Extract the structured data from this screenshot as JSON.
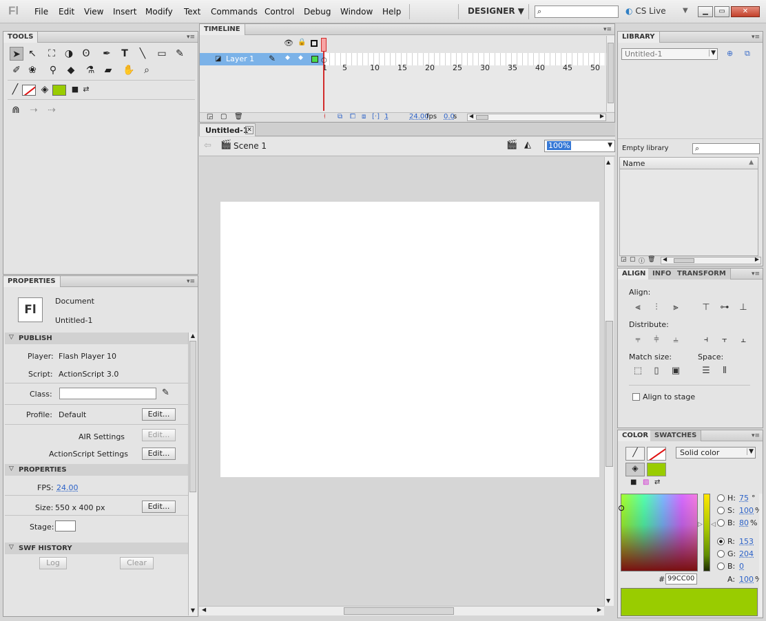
{
  "app": {
    "logo": "Fl",
    "menu": [
      "File",
      "Edit",
      "View",
      "Insert",
      "Modify",
      "Text",
      "Commands",
      "Control",
      "Debug",
      "Window",
      "Help"
    ],
    "workspace": "DESIGNER",
    "cs_live": "CS Live"
  },
  "tools_panel": {
    "title": "TOOLS"
  },
  "timeline": {
    "title": "TIMELINE",
    "layer_name": "Layer 1",
    "frame_numbers": [
      "1",
      "5",
      "10",
      "15",
      "20",
      "25",
      "30",
      "35",
      "40",
      "45",
      "50"
    ],
    "current_frame": "1",
    "fps": "24.00",
    "fps_unit": "fps",
    "time": "0.0",
    "time_unit": "s"
  },
  "document_tab": {
    "title": "Untitled-1",
    "scene": "Scene 1",
    "zoom": "100%"
  },
  "properties": {
    "title": "PROPERTIES",
    "doc_icon": "Fl",
    "doc_type": "Document",
    "doc_name": "Untitled-1",
    "publish_header": "PUBLISH",
    "player_label": "Player:",
    "player_value": "Flash Player 10",
    "script_label": "Script:",
    "script_value": "ActionScript 3.0",
    "class_label": "Class:",
    "profile_label": "Profile:",
    "profile_value": "Default",
    "edit_label": "Edit...",
    "air_settings": "AIR Settings",
    "as_settings": "ActionScript Settings",
    "props_header": "PROPERTIES",
    "fps_label": "FPS:",
    "fps_value": "24.00",
    "size_label": "Size:",
    "size_value": "550 x 400 px",
    "stage_label": "Stage:",
    "swf_header": "SWF HISTORY",
    "log_label": "Log",
    "clear_label": "Clear"
  },
  "library": {
    "title": "LIBRARY",
    "doc_select": "Untitled-1",
    "empty": "Empty library",
    "name_col": "Name"
  },
  "align": {
    "tabs": [
      "ALIGN",
      "INFO",
      "TRANSFORM"
    ],
    "align_label": "Align:",
    "distribute_label": "Distribute:",
    "match_label": "Match size:",
    "space_label": "Space:",
    "align_to_stage": "Align to stage"
  },
  "color": {
    "tabs": [
      "COLOR",
      "SWATCHES"
    ],
    "fill_type": "Solid color",
    "h_label": "H:",
    "h_value": "75",
    "h_unit": "°",
    "s_label": "S:",
    "s_value": "100",
    "s_unit": "%",
    "b_label": "B:",
    "b_value": "80",
    "b_unit": "%",
    "r_label": "R:",
    "r_value": "153",
    "g_label": "G:",
    "g_value": "204",
    "b2_label": "B:",
    "b2_value": "0",
    "a_label": "A:",
    "a_value": "100",
    "a_unit": "%",
    "hex_label": "#",
    "hex_value": "99CC00",
    "fill_color": "#99CC00"
  }
}
